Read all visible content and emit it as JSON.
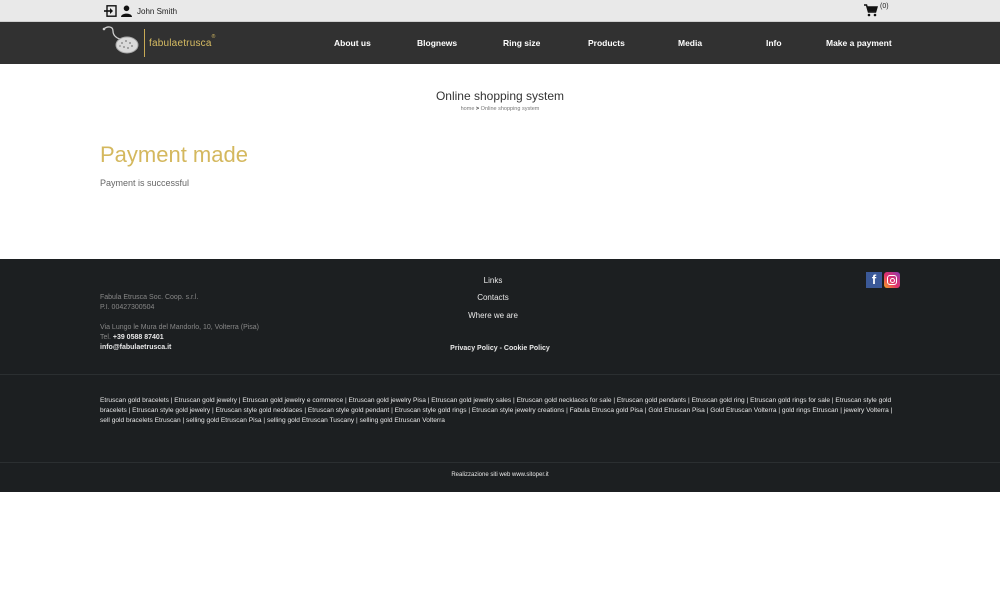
{
  "topbar": {
    "user_name": "John Smith",
    "cart_count": "(0)"
  },
  "brand": {
    "logo_text": "fabulaetrusca",
    "logo_reg": "®",
    "accent_color": "#d4b85e"
  },
  "nav": {
    "items": [
      {
        "label": "About us"
      },
      {
        "label": "Blognews"
      },
      {
        "label": "Ring size"
      },
      {
        "label": "Products"
      },
      {
        "label": "Media"
      },
      {
        "label": "Info"
      },
      {
        "label": "Make a payment"
      }
    ]
  },
  "main": {
    "heading": "Online shopping system",
    "breadcrumb_home": "home",
    "breadcrumb_sep": ">",
    "breadcrumb_current": "Online shopping system",
    "title": "Payment made",
    "message": "Payment is successful"
  },
  "footer": {
    "company_name": "Fabula Etrusca Soc. Coop. s.r.l.",
    "vat": "P.I. 00427300504",
    "address": "Via Lungo le Mura del Mandorlo, 10, Volterra (Pisa)",
    "tel_label": "Tel.",
    "tel_number": "+39 0588 87401",
    "email": "info@fabulaetrusca.it",
    "links": [
      {
        "label": "Links"
      },
      {
        "label": "Contacts"
      },
      {
        "label": "Where we are"
      }
    ],
    "privacy": "Privacy Policy",
    "policy_sep": "-",
    "cookie": "Cookie Policy",
    "social": {
      "facebook_glyph": "f"
    },
    "tags": [
      "Etruscan gold bracelets",
      "Etruscan gold jewelry",
      "Etruscan gold jewelry e commerce",
      "Etruscan gold jewelry Pisa",
      "Etruscan gold jewelry sales",
      "Etruscan gold necklaces for sale",
      "Etruscan gold pendants",
      "Etruscan gold ring",
      "Etruscan gold rings for sale",
      "Etruscan style gold bracelets",
      "Etruscan style gold jewelry",
      "Etruscan style gold necklaces",
      "Etruscan style gold pendant",
      "Etruscan style gold rings",
      "Etruscan style jewelry creations",
      "Fabula Etrusca gold Pisa",
      "Gold Etruscan Pisa",
      "Gold Etruscan Volterra",
      "gold rings Etruscan",
      "jewelry Volterra",
      "sell gold bracelets Etruscan",
      "selling gold Etruscan Pisa",
      "selling gold Etruscan Tuscany",
      "selling gold Etruscan Volterra"
    ],
    "tag_sep": "|",
    "credits": "Realizzazione siti web www.sitoper.it"
  }
}
